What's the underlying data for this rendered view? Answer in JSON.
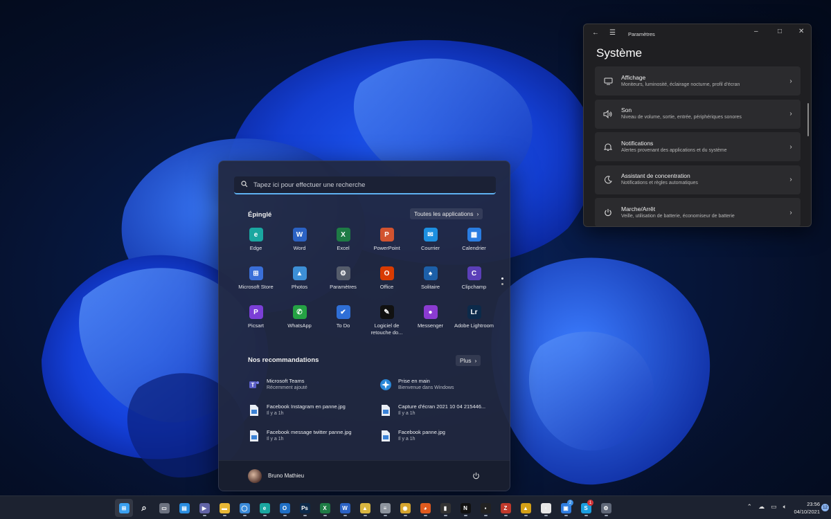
{
  "colors": {
    "accent": "#5fb2f2",
    "start_bg": "#21283e",
    "settings_bg": "#1f1f22",
    "taskbar_bg": "#1c2230"
  },
  "start_menu": {
    "search_placeholder": "Tapez ici pour effectuer une recherche",
    "pinned_title": "Épinglé",
    "all_apps_label": "Toutes les applications",
    "pinned": [
      {
        "label": "Edge",
        "icon": "edge-icon",
        "color": "#1aa7a0",
        "glyph": "e"
      },
      {
        "label": "Word",
        "icon": "word-icon",
        "color": "#2b62c4",
        "glyph": "W"
      },
      {
        "label": "Excel",
        "icon": "excel-icon",
        "color": "#1e7b45",
        "glyph": "X"
      },
      {
        "label": "PowerPoint",
        "icon": "powerpoint-icon",
        "color": "#d2532f",
        "glyph": "P"
      },
      {
        "label": "Courrier",
        "icon": "mail-icon",
        "color": "#1d8fe0",
        "glyph": "✉"
      },
      {
        "label": "Calendrier",
        "icon": "calendar-icon",
        "color": "#2a7de1",
        "glyph": "▦"
      },
      {
        "label": "Microsoft Store",
        "icon": "store-icon",
        "color": "#3a6fd8",
        "glyph": "⊞"
      },
      {
        "label": "Photos",
        "icon": "photos-icon",
        "color": "#3d8fd6",
        "glyph": "▲"
      },
      {
        "label": "Paramètres",
        "icon": "settings-gear-icon",
        "color": "#555c6b",
        "glyph": "⚙"
      },
      {
        "label": "Office",
        "icon": "office-icon",
        "color": "#d83b01",
        "glyph": "O"
      },
      {
        "label": "Solitaire",
        "icon": "solitaire-icon",
        "color": "#1c5fa8",
        "glyph": "♠"
      },
      {
        "label": "Clipchamp",
        "icon": "clipchamp-icon",
        "color": "#5b3fb8",
        "glyph": "C"
      },
      {
        "label": "Picsart",
        "icon": "picsart-icon",
        "color": "#7b3fd6",
        "glyph": "P"
      },
      {
        "label": "WhatsApp",
        "icon": "whatsapp-icon",
        "color": "#25a244",
        "glyph": "✆"
      },
      {
        "label": "To Do",
        "icon": "todo-icon",
        "color": "#2f6fd6",
        "glyph": "✔"
      },
      {
        "label": "Logiciel de retouche do...",
        "icon": "photo-editor-icon",
        "color": "#111111",
        "glyph": "✎"
      },
      {
        "label": "Messenger",
        "icon": "messenger-icon",
        "color": "#8a3bd1",
        "glyph": "●"
      },
      {
        "label": "Adobe Lightroom",
        "icon": "lightroom-icon",
        "color": "#0c2a4a",
        "glyph": "Lr"
      }
    ],
    "recommended_title": "Nos recommandations",
    "more_label": "Plus",
    "recommended": [
      {
        "title": "Microsoft Teams",
        "subtitle": "Récemment ajouté",
        "icon": "teams-icon"
      },
      {
        "title": "Prise en main",
        "subtitle": "Bienvenue dans Windows",
        "icon": "tips-icon"
      },
      {
        "title": "Facebook Instagram en panne.jpg",
        "subtitle": "Il y a 1h",
        "icon": "image-file-icon"
      },
      {
        "title": "Capture d'écran 2021 10 04 215446...",
        "subtitle": "Il y a 1h",
        "icon": "image-file-icon"
      },
      {
        "title": "Facebook message twitter panne.jpg",
        "subtitle": "Il y a 1h",
        "icon": "image-file-icon"
      },
      {
        "title": "Facebook panne.jpg",
        "subtitle": "Il y a 1h",
        "icon": "image-file-icon"
      }
    ],
    "user_name": "Bruno Mathieu"
  },
  "settings_window": {
    "window_title": "Paramètres",
    "heading": "Système",
    "items": [
      {
        "title": "Affichage",
        "subtitle": "Moniteurs, luminosité, éclairage nocturne, profil d'écran",
        "icon": "monitor-icon"
      },
      {
        "title": "Son",
        "subtitle": "Niveau de volume, sortie, entrée, périphériques sonores",
        "icon": "speaker-icon"
      },
      {
        "title": "Notifications",
        "subtitle": "Alertes provenant des applications et du système",
        "icon": "bell-icon"
      },
      {
        "title": "Assistant de concentration",
        "subtitle": "Notifications et règles automatiques",
        "icon": "moon-icon"
      },
      {
        "title": "Marche/Arrêt",
        "subtitle": "Veille, utilisation de batterie, économiseur de batterie",
        "icon": "power-icon"
      }
    ]
  },
  "taskbar": {
    "apps": [
      {
        "name": "start",
        "icon": "windows-start-icon",
        "color": "#3aa0f0",
        "glyph": "⊞",
        "active": true
      },
      {
        "name": "search",
        "icon": "search-icon",
        "color": "transparent",
        "glyph": "⌕"
      },
      {
        "name": "task-view",
        "icon": "task-view-icon",
        "color": "#6c7280",
        "glyph": "▭"
      },
      {
        "name": "widgets",
        "icon": "widgets-icon",
        "color": "#2a8de0",
        "glyph": "▤"
      },
      {
        "name": "teams-chat",
        "icon": "chat-icon",
        "color": "#6264a7",
        "glyph": "▶"
      },
      {
        "name": "file-explorer",
        "icon": "folder-icon",
        "color": "#e8b735",
        "glyph": "▬"
      },
      {
        "name": "messenger",
        "icon": "messenger-icon",
        "color": "#3a8ad8",
        "glyph": "◯"
      },
      {
        "name": "edge",
        "icon": "edge-icon",
        "color": "#1aa7a0",
        "glyph": "e"
      },
      {
        "name": "outlook",
        "icon": "outlook-icon",
        "color": "#1f6fc5",
        "glyph": "O"
      },
      {
        "name": "photoshop",
        "icon": "photoshop-icon",
        "color": "#0c2a4a",
        "glyph": "Ps"
      },
      {
        "name": "excel",
        "icon": "excel-icon",
        "color": "#1e7b45",
        "glyph": "X"
      },
      {
        "name": "word",
        "icon": "word-icon",
        "color": "#2b62c4",
        "glyph": "W"
      },
      {
        "name": "app-steam",
        "icon": "app-icon",
        "color": "#d9b640",
        "glyph": "▲"
      },
      {
        "name": "notepad",
        "icon": "notepad-icon",
        "color": "#8d949e",
        "glyph": "≡"
      },
      {
        "name": "chrome",
        "icon": "chrome-icon",
        "color": "#d6a52e",
        "glyph": "◉"
      },
      {
        "name": "firefox",
        "icon": "firefox-icon",
        "color": "#e05a1e",
        "glyph": "◕"
      },
      {
        "name": "app-dark",
        "icon": "app-icon",
        "color": "#333333",
        "glyph": "▮"
      },
      {
        "name": "netflix",
        "icon": "netflix-icon",
        "color": "#111111",
        "glyph": "N"
      },
      {
        "name": "app-ocb",
        "icon": "app-icon",
        "color": "#222222",
        "glyph": "▪"
      },
      {
        "name": "filezilla",
        "icon": "filezilla-icon",
        "color": "#c0392b",
        "glyph": "Z"
      },
      {
        "name": "app-triangle",
        "icon": "app-icon",
        "color": "#d4a017",
        "glyph": "▲"
      },
      {
        "name": "app-doc",
        "icon": "app-icon",
        "color": "#e8e8e8",
        "glyph": "▫"
      },
      {
        "name": "app-blue",
        "icon": "app-icon",
        "color": "#2f7de0",
        "glyph": "▣",
        "badge": "2",
        "badge_color": "#3a8ee6"
      },
      {
        "name": "skype",
        "icon": "skype-icon",
        "color": "#1a9ee0",
        "glyph": "S",
        "badge": "1",
        "badge_color": "#d13438"
      },
      {
        "name": "settings",
        "icon": "settings-gear-icon",
        "color": "#606878",
        "glyph": "⚙"
      }
    ],
    "tray_icons": [
      "chevron-up-icon",
      "cloud-icon",
      "battery-icon",
      "speaker-icon"
    ],
    "time": "23:56",
    "date": "04/10/2021",
    "notifications_count": "12"
  }
}
